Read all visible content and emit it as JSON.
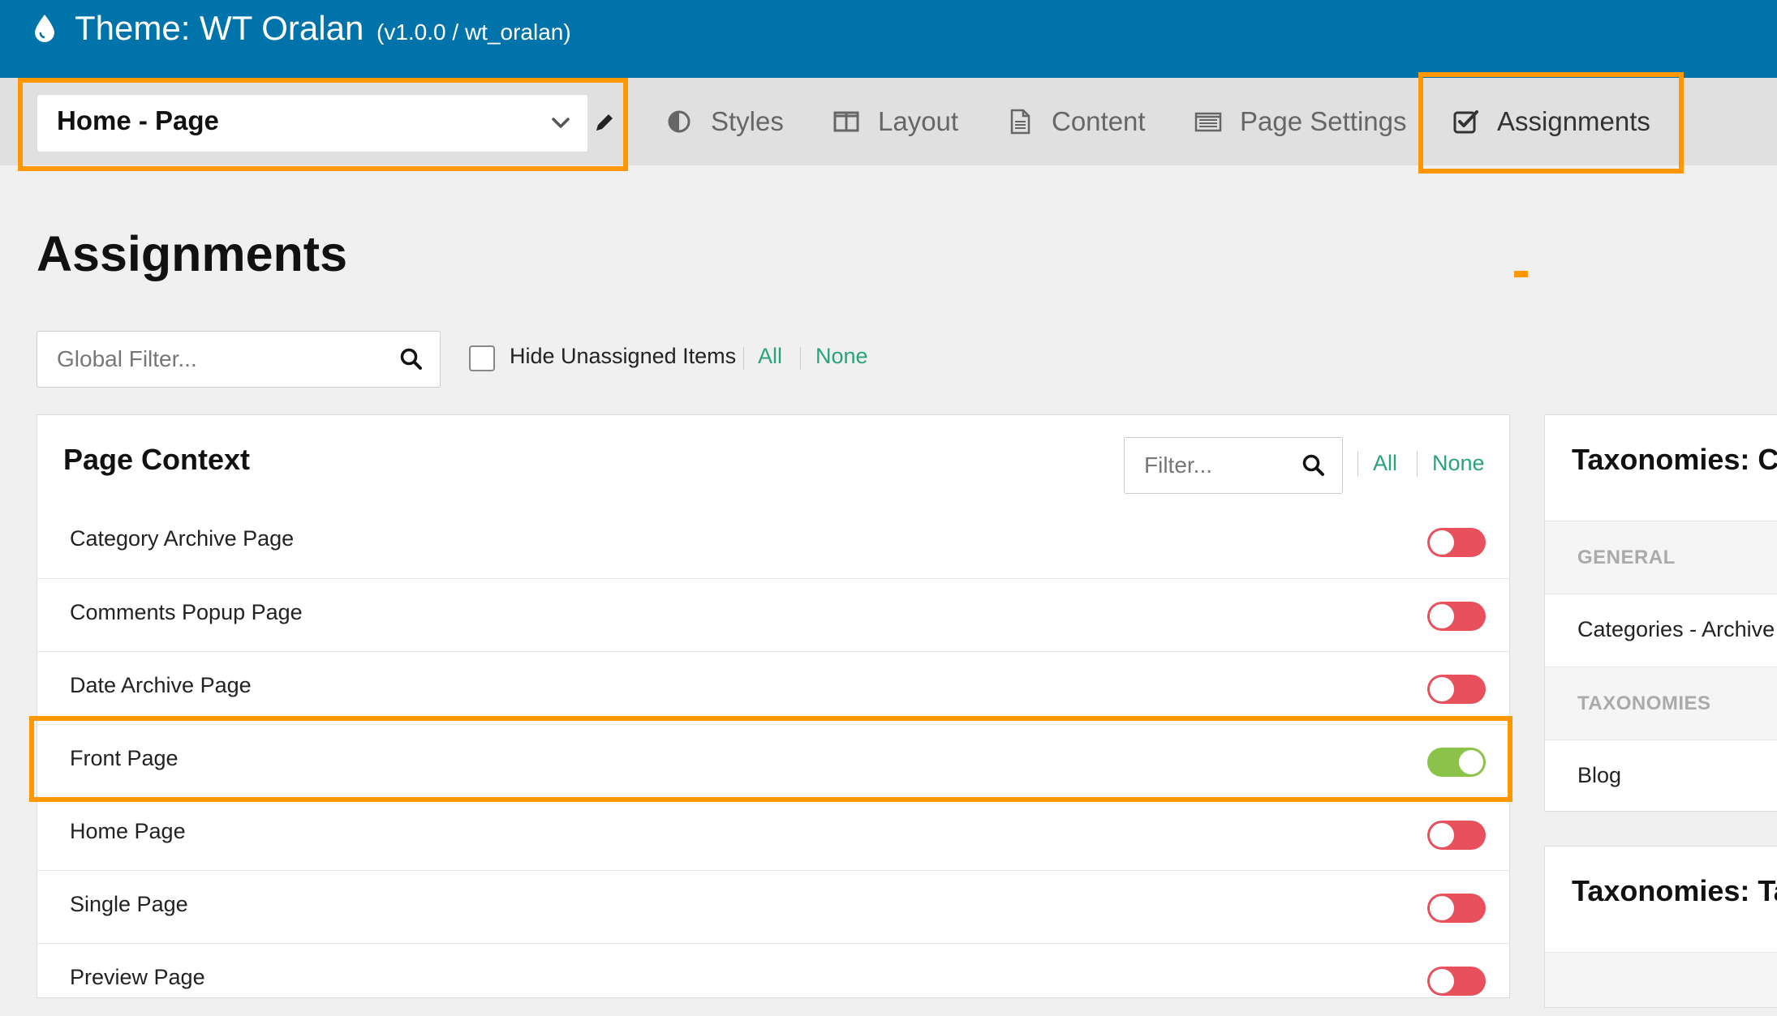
{
  "header": {
    "title": "Theme: WT Oralan",
    "version": "(v1.0.0 / wt_oralan)"
  },
  "toolbar": {
    "page_select_value": "Home - Page",
    "tabs": [
      {
        "label": "Styles",
        "icon": "contrast-icon"
      },
      {
        "label": "Layout",
        "icon": "columns-icon"
      },
      {
        "label": "Content",
        "icon": "document-icon"
      },
      {
        "label": "Page Settings",
        "icon": "list-window-icon"
      },
      {
        "label": "Assignments",
        "icon": "checkbox-icon",
        "active": true
      }
    ]
  },
  "main": {
    "heading": "Assignments",
    "global_filter_placeholder": "Global Filter...",
    "hide_unassigned_label": "Hide Unassigned Items",
    "hide_unassigned_checked": false,
    "all_label": "All",
    "none_label": "None"
  },
  "page_context": {
    "title": "Page Context",
    "filter_placeholder": "Filter...",
    "all_label": "All",
    "none_label": "None",
    "items": [
      {
        "label": "Category Archive Page",
        "enabled": false
      },
      {
        "label": "Comments Popup Page",
        "enabled": false
      },
      {
        "label": "Date Archive Page",
        "enabled": false
      },
      {
        "label": "Front Page",
        "enabled": true
      },
      {
        "label": "Home Page",
        "enabled": false
      },
      {
        "label": "Single Page",
        "enabled": false
      },
      {
        "label": "Preview Page",
        "enabled": false
      }
    ]
  },
  "taxonomies_categories": {
    "title": "Taxonomies: Ca",
    "group_general": "GENERAL",
    "item_general": "Categories - Archive V",
    "group_taxonomies": "TAXONOMIES",
    "item_taxonomy": "Blog"
  },
  "taxonomies_tags": {
    "title": "Taxonomies: Ta"
  },
  "colors": {
    "header_bg": "#0073aa",
    "highlight": "#ff9800",
    "link": "#2aa37c",
    "toggle_off": "#e8505b",
    "toggle_on": "#8bc34a"
  }
}
